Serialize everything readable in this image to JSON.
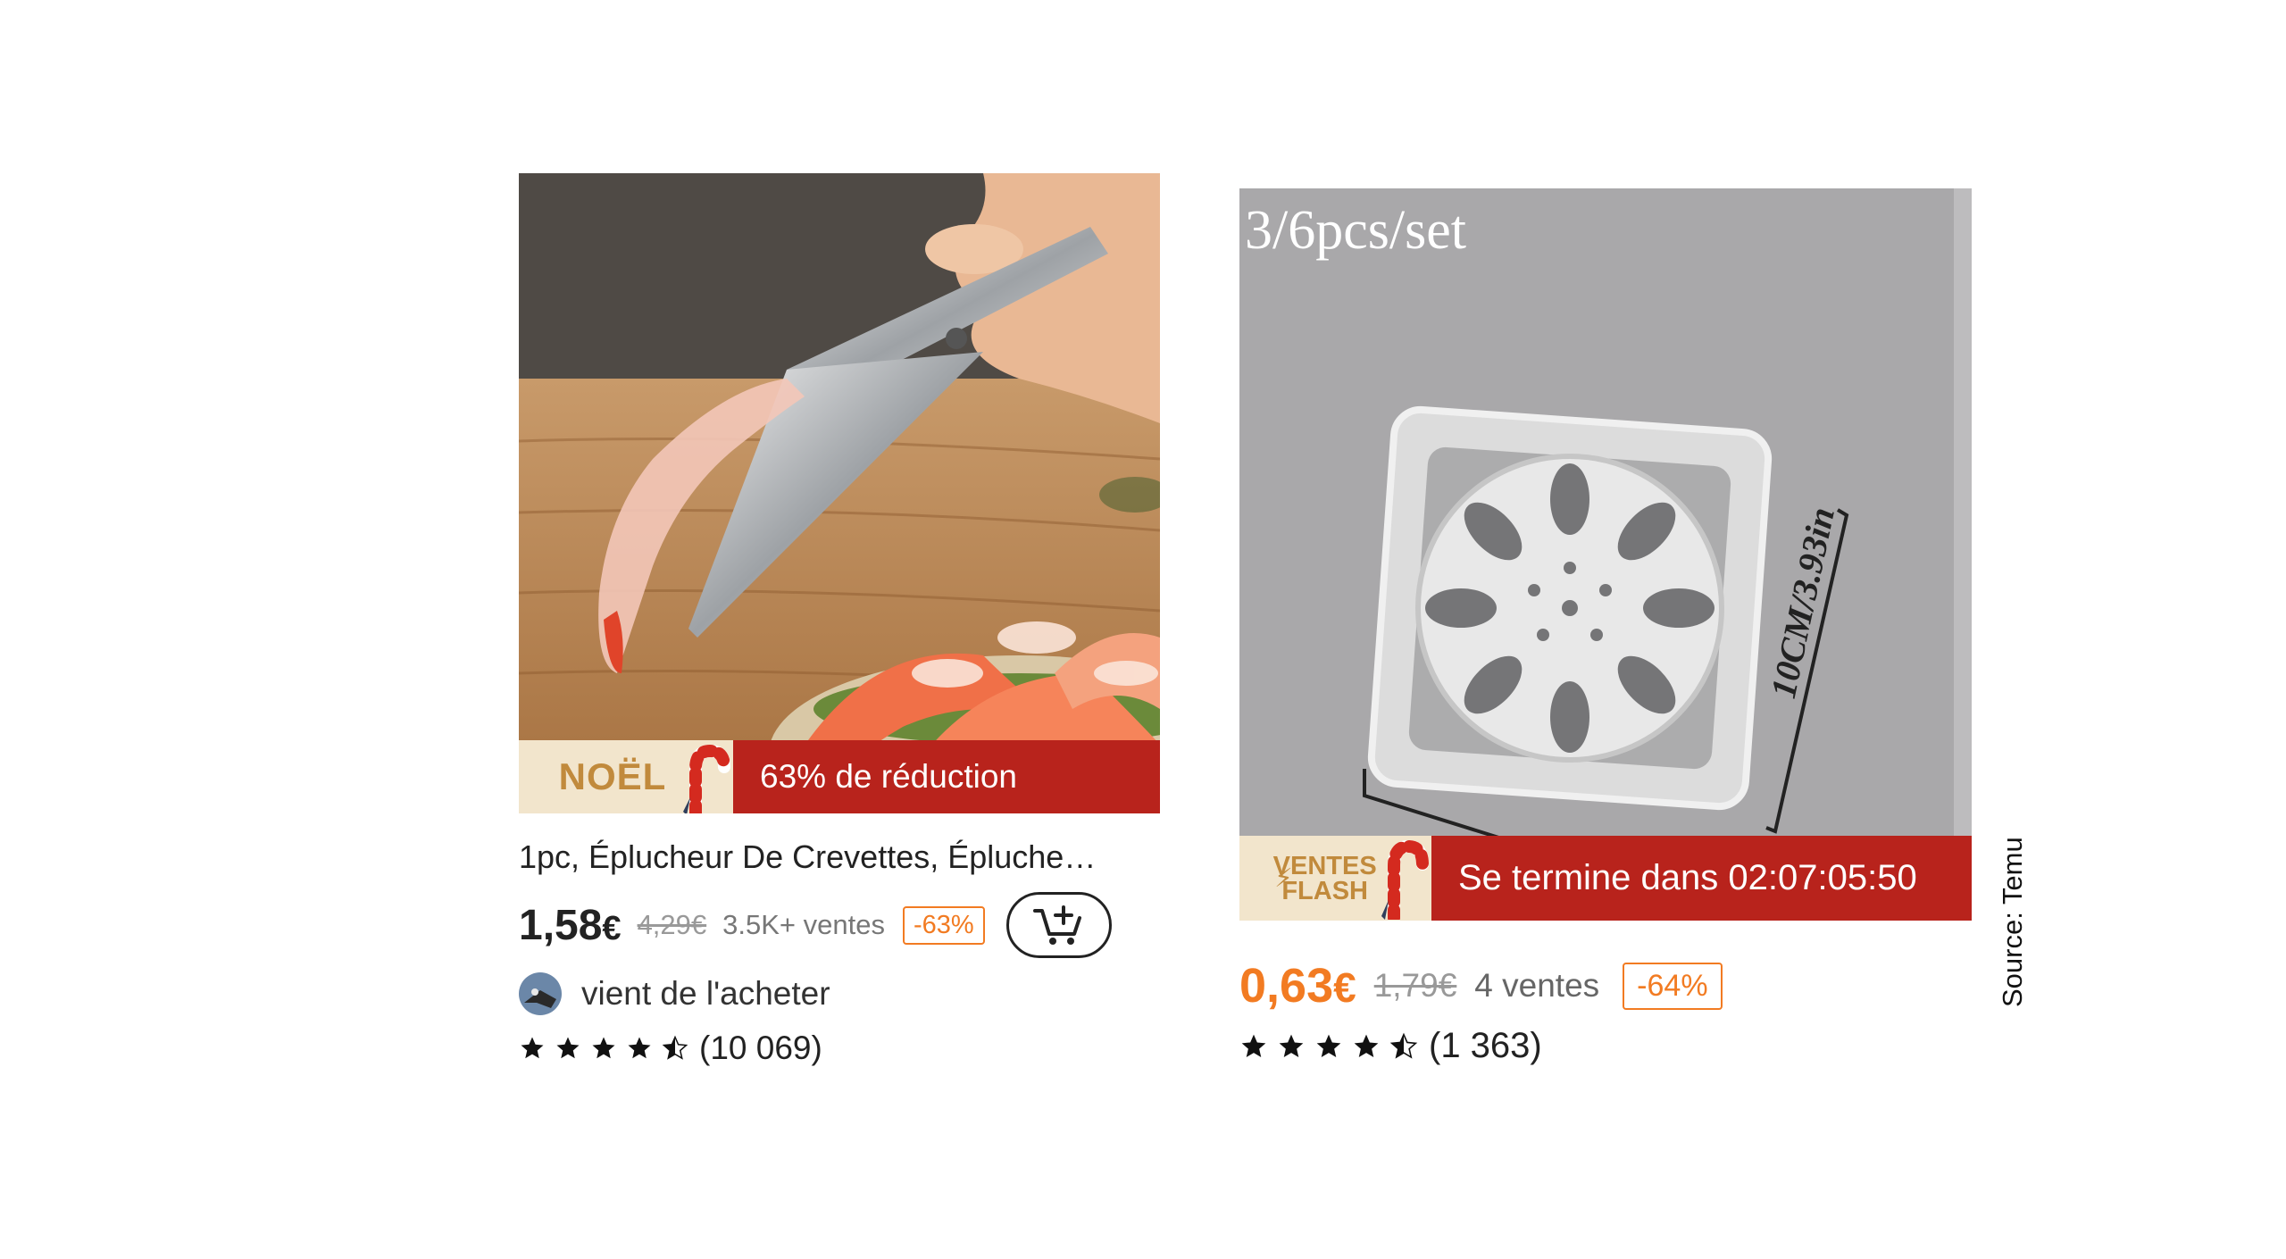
{
  "products": [
    {
      "banner": {
        "tag": "NOËL",
        "text": "63% de réduction"
      },
      "title": "1pc, Éplucheur De Crevettes, Épluche…",
      "price": "1,58",
      "currency": "€",
      "old_price": "4,29€",
      "sales": "3.5K+ ventes",
      "discount": "-63%",
      "buyer_text": "vient de l'acheter",
      "rating": 4.5,
      "reviews": "(10 069)",
      "icons": [
        "cart-add-icon",
        "candy-cane-icon",
        "star-icon"
      ]
    },
    {
      "image_text": "3/6pcs/set",
      "dimension_label": "10CM/3.93in",
      "banner": {
        "tag_line1": "VENTES",
        "tag_line2": "FLASH",
        "text": "Se termine dans 02:07:05:50"
      },
      "price": "0,63",
      "currency": "€",
      "old_price": "1,79€",
      "sales": "4 ventes",
      "discount": "-64%",
      "rating": 4.5,
      "reviews": "(1 363)",
      "icons": [
        "lightning-icon",
        "candy-cane-icon",
        "star-icon"
      ]
    }
  ],
  "source": "Source: Temu",
  "colors": {
    "banner_red": "#b8231c",
    "tag_cream": "#f2e5cc",
    "accent_orange": "#f27b22",
    "tag_gold": "#c18a3c"
  }
}
